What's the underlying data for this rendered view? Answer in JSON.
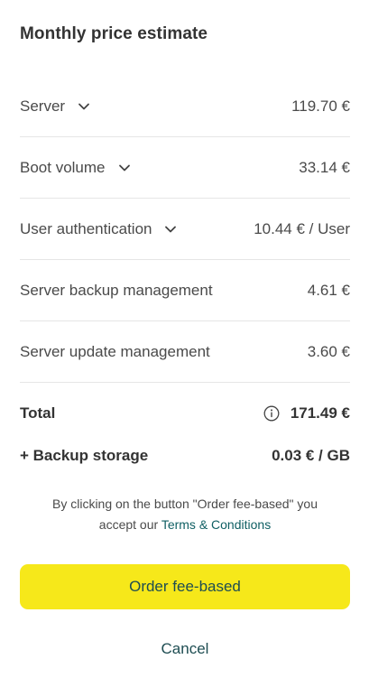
{
  "title": "Monthly price estimate",
  "rows": [
    {
      "label": "Server",
      "value": "119.70 €",
      "expandable": true
    },
    {
      "label": "Boot volume",
      "value": "33.14 €",
      "expandable": true
    },
    {
      "label": "User authentication",
      "value": "10.44 € / User",
      "expandable": true
    },
    {
      "label": "Server backup management",
      "value": "4.61 €",
      "expandable": false
    },
    {
      "label": "Server update management",
      "value": "3.60 €",
      "expandable": false
    }
  ],
  "total": {
    "label": "Total",
    "value": "171.49 €",
    "icon": "info-icon"
  },
  "backup_storage": {
    "label": "+ Backup storage",
    "value": "0.03 € / GB"
  },
  "terms": {
    "line1": "By clicking on the button \"Order fee-based\" you",
    "line2_prefix": "accept our ",
    "link": "Terms & Conditions"
  },
  "buttons": {
    "order": "Order fee-based",
    "cancel": "Cancel"
  },
  "colors": {
    "accent_button": "#f6e81a",
    "button_text": "#1e4d52",
    "link": "#0f5f63"
  }
}
